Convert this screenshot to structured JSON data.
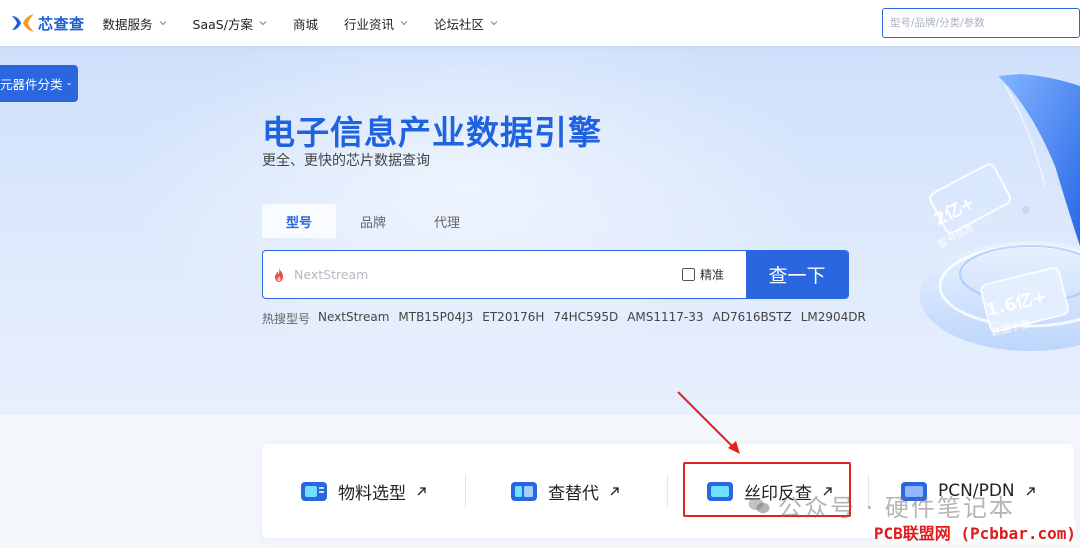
{
  "brand": {
    "name": "芯查查"
  },
  "nav": {
    "items": [
      {
        "label": "数据服务",
        "dropdown": true
      },
      {
        "label": "SaaS/方案",
        "dropdown": true
      },
      {
        "label": "商城",
        "dropdown": false
      },
      {
        "label": "行业资讯",
        "dropdown": true
      },
      {
        "label": "论坛社区",
        "dropdown": true
      }
    ],
    "search_placeholder": "型号/品牌/分类/参数"
  },
  "sidebar": {
    "category_label": "元器件分类"
  },
  "hero": {
    "title": "电子信息产业数据引擎",
    "subtitle": "更全、更快的芯片数据查询",
    "tabs": [
      {
        "label": "型号",
        "active": true
      },
      {
        "label": "品牌",
        "active": false
      },
      {
        "label": "代理",
        "active": false
      }
    ],
    "search": {
      "placeholder": "NextStream",
      "exact_label": "精准",
      "exact_checked": false,
      "button_label": "查一下"
    },
    "hot": {
      "label": "热搜型号",
      "items": [
        "NextStream",
        "MTB15P04J3",
        "ET20176H",
        "74HC595D",
        "AMS1117-33",
        "AD7616BSTZ",
        "LM2904DR"
      ]
    },
    "art": {
      "badge1": "2亿+",
      "badge1_sub": "型号信息",
      "badge2": "1.6亿+",
      "badge2_sub": "数据手册"
    }
  },
  "features": [
    {
      "label": "物料选型"
    },
    {
      "label": "查替代"
    },
    {
      "label": "丝印反查"
    },
    {
      "label": "PCN/PDN"
    }
  ],
  "watermarks": {
    "wechat": "公众号 · 硬件笔记本",
    "site": "PCB联盟网 (Pcbbar.com)"
  },
  "colors": {
    "primary": "#2a66e0",
    "title": "#1f63e0",
    "highlight": "#e52121"
  }
}
